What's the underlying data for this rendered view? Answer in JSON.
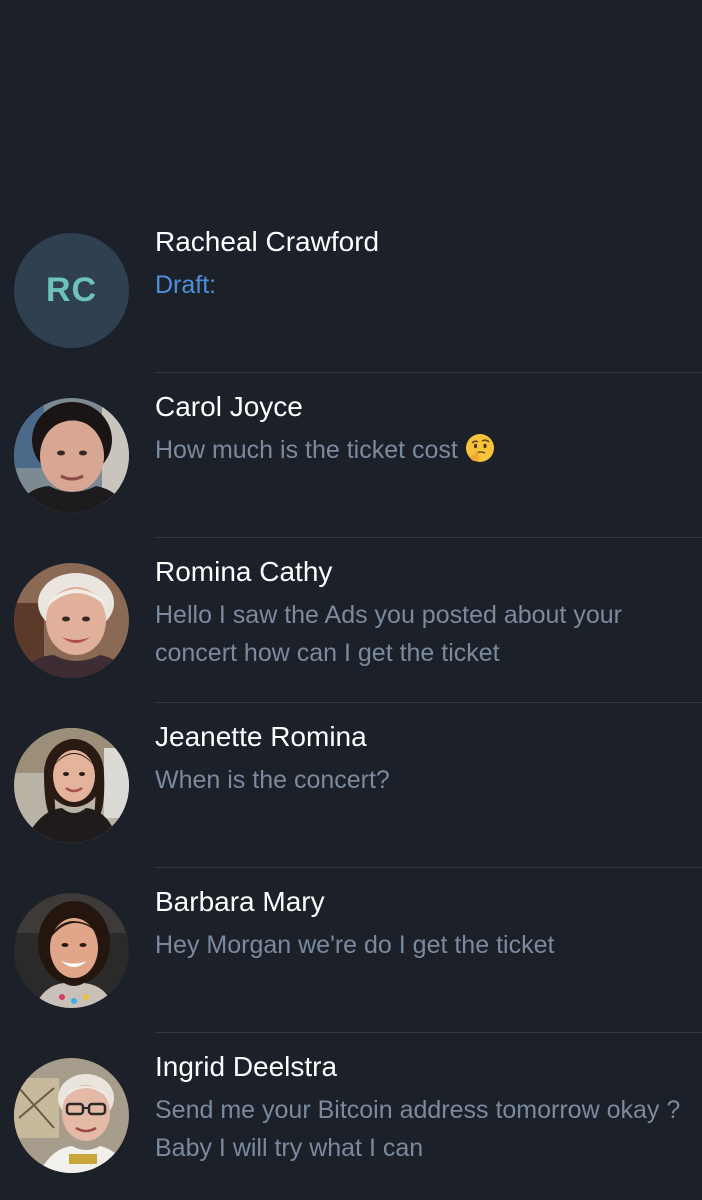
{
  "chats": [
    {
      "name": "Racheal Crawford",
      "initials": "RC",
      "preview": "Draft:",
      "avatar_type": "initials",
      "avatar_bg": "#2f4051",
      "initials_color": "#6ec1bd"
    },
    {
      "name": "Carol Joyce",
      "preview": "How much is the ticket cost",
      "trailing_emoji": "thinking-face-icon",
      "avatar_type": "photo"
    },
    {
      "name": "Romina Cathy",
      "preview": "Hello I saw the Ads you posted about your concert how can I get the ticket",
      "avatar_type": "photo"
    },
    {
      "name": "Jeanette Romina",
      "preview": "When is the concert?",
      "avatar_type": "photo"
    },
    {
      "name": "Barbara Mary",
      "preview": "Hey Morgan we're do I get the ticket",
      "avatar_type": "photo"
    },
    {
      "name": "Ingrid Deelstra",
      "preview": "Send me your Bitcoin address tomorrow okay ? Baby I will try what I can",
      "avatar_type": "photo"
    }
  ],
  "colors": {
    "background": "#1b2029",
    "name_text": "#ffffff",
    "preview_text": "#7c8a9e",
    "draft_text": "#4e8fdc",
    "divider": "#313945"
  }
}
